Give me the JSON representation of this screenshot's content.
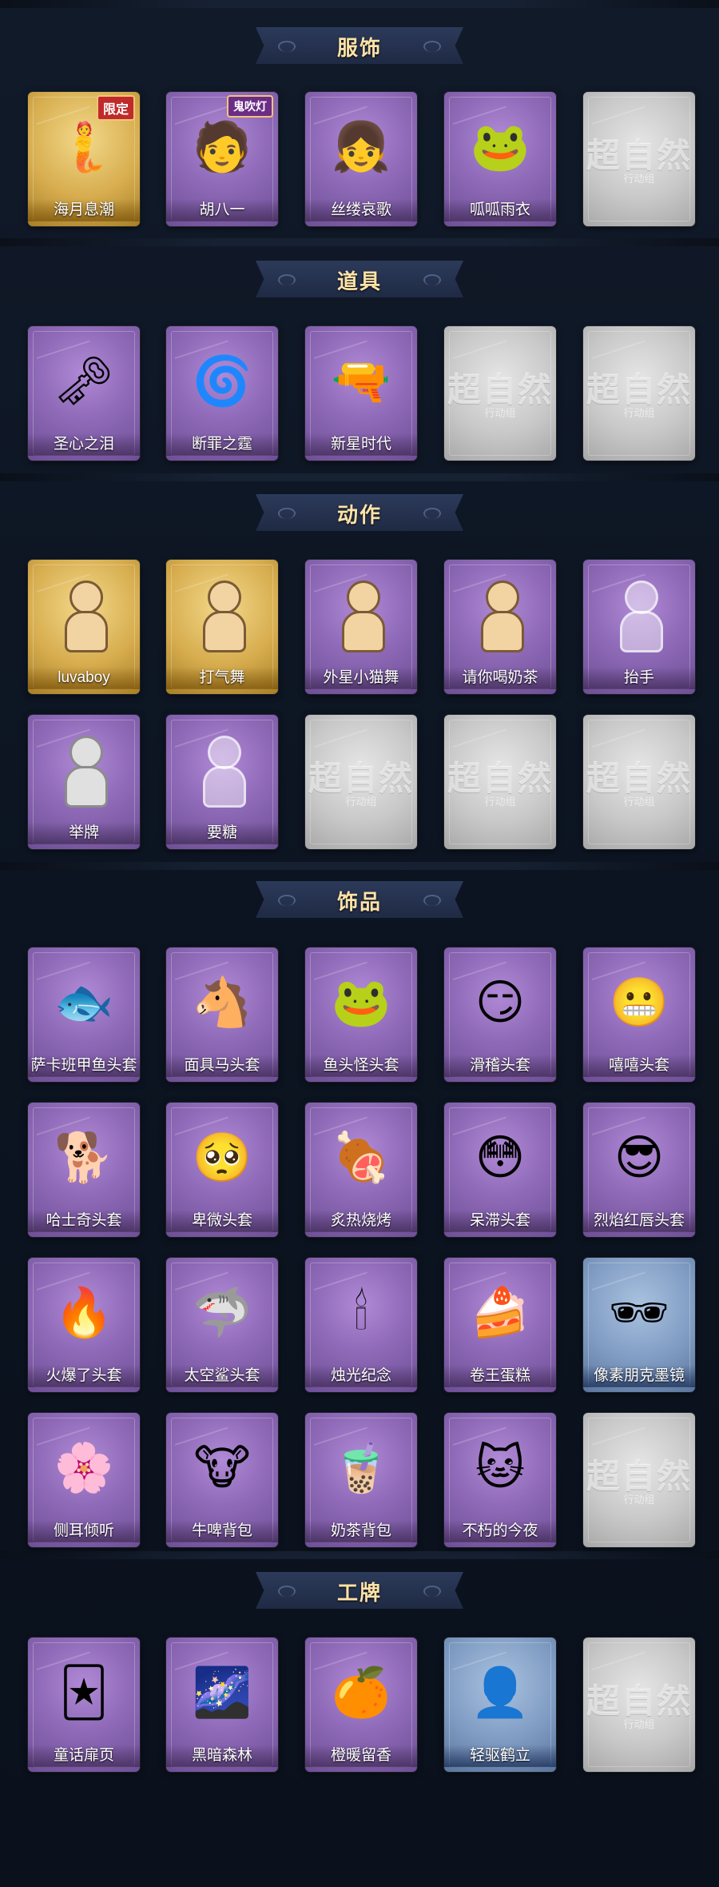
{
  "sections": [
    {
      "title": "服饰",
      "items": [
        {
          "label": "海月息潮",
          "tier": "gold",
          "icon": "sea-goddess-portrait-icon",
          "glyph": "🧜",
          "badge": "限定"
        },
        {
          "label": "胡八一",
          "tier": "purple",
          "icon": "hero-portrait-icon",
          "glyph": "🧑",
          "badge": "鬼吹灯"
        },
        {
          "label": "丝缕哀歌",
          "tier": "purple",
          "icon": "gothic-girl-portrait-icon",
          "glyph": "👧"
        },
        {
          "label": "呱呱雨衣",
          "tier": "purple",
          "icon": "frog-raincoat-girl-icon",
          "glyph": "🐸"
        },
        {
          "label": "",
          "tier": "silver",
          "placeholder": true
        }
      ]
    },
    {
      "title": "道具",
      "items": [
        {
          "label": "圣心之泪",
          "tier": "purple",
          "icon": "ruby-scepter-icon",
          "glyph": "🗝"
        },
        {
          "label": "断罪之霆",
          "tier": "purple",
          "icon": "spiral-orb-icon",
          "glyph": "🌀"
        },
        {
          "label": "新星时代",
          "tier": "purple",
          "icon": "revolver-icon",
          "glyph": "🔫"
        },
        {
          "label": "",
          "tier": "silver",
          "placeholder": true
        },
        {
          "label": "",
          "tier": "silver",
          "placeholder": true
        }
      ]
    },
    {
      "title": "动作",
      "items": [
        {
          "label": "luvaboy",
          "tier": "gold",
          "icon": "dance-pose-icon",
          "figure": "tan"
        },
        {
          "label": "打气舞",
          "tier": "gold",
          "icon": "cheer-dance-icon",
          "figure": "tan"
        },
        {
          "label": "外星小猫舞",
          "tier": "purple",
          "icon": "alien-cat-dance-icon",
          "figure": "tan"
        },
        {
          "label": "请你喝奶茶",
          "tier": "purple",
          "icon": "milk-tea-offer-icon",
          "figure": "tan"
        },
        {
          "label": "抬手",
          "tier": "purple",
          "icon": "raise-hand-icon",
          "figure": "faded"
        },
        {
          "label": "举牌",
          "tier": "purple",
          "icon": "hold-sign-icon",
          "figure": "grey"
        },
        {
          "label": "要糖",
          "tier": "purple",
          "icon": "ask-candy-icon",
          "figure": "faded"
        },
        {
          "label": "",
          "tier": "silver",
          "placeholder": true
        },
        {
          "label": "",
          "tier": "silver",
          "placeholder": true
        },
        {
          "label": "",
          "tier": "silver",
          "placeholder": true
        }
      ]
    },
    {
      "title": "饰品",
      "items": [
        {
          "label": "萨卡班甲鱼头套",
          "tier": "purple",
          "icon": "fish-head-mask-icon",
          "glyph": "🐟"
        },
        {
          "label": "面具马头套",
          "tier": "purple",
          "icon": "horse-head-mask-icon",
          "glyph": "🐴"
        },
        {
          "label": "鱼头怪头套",
          "tier": "purple",
          "icon": "green-fish-mask-icon",
          "glyph": "🐸"
        },
        {
          "label": "滑稽头套",
          "tier": "purple",
          "icon": "funny-face-mask-icon",
          "glyph": "😏"
        },
        {
          "label": "嘻嘻头套",
          "tier": "purple",
          "icon": "grin-face-mask-icon",
          "glyph": "😬"
        },
        {
          "label": "哈士奇头套",
          "tier": "purple",
          "icon": "husky-mask-icon",
          "glyph": "🐕"
        },
        {
          "label": "卑微头套",
          "tier": "purple",
          "icon": "humble-face-mask-icon",
          "glyph": "🥺"
        },
        {
          "label": "炙热烧烤",
          "tier": "purple",
          "icon": "bbq-meat-icon",
          "glyph": "🍖"
        },
        {
          "label": "呆滞头套",
          "tier": "purple",
          "icon": "dazed-face-mask-icon",
          "glyph": "😳"
        },
        {
          "label": "烈焰红唇头套",
          "tier": "purple",
          "icon": "yellow-mouse-mask-icon",
          "glyph": "😎"
        },
        {
          "label": "火爆了头套",
          "tier": "purple",
          "icon": "fire-head-mask-icon",
          "glyph": "🔥"
        },
        {
          "label": "太空鲨头套",
          "tier": "purple",
          "icon": "space-shark-mask-icon",
          "glyph": "🦈"
        },
        {
          "label": "烛光纪念",
          "tier": "purple",
          "icon": "candle-head-icon",
          "glyph": "🕯"
        },
        {
          "label": "卷王蛋糕",
          "tier": "purple",
          "icon": "roll-cake-icon",
          "glyph": "🍰"
        },
        {
          "label": "像素朋克墨镜",
          "tier": "blue",
          "icon": "pixel-sunglasses-icon",
          "glyph": "🕶"
        },
        {
          "label": "侧耳倾听",
          "tier": "purple",
          "icon": "flower-earring-icon",
          "glyph": "🌸"
        },
        {
          "label": "牛啤背包",
          "tier": "purple",
          "icon": "cow-beer-backpack-icon",
          "glyph": "🐮"
        },
        {
          "label": "奶茶背包",
          "tier": "purple",
          "icon": "milk-tea-backpack-icon",
          "glyph": "🧋"
        },
        {
          "label": "不朽的今夜",
          "tier": "purple",
          "icon": "pink-cat-ornament-icon",
          "glyph": "🐱"
        },
        {
          "label": "",
          "tier": "silver",
          "placeholder": true
        }
      ]
    },
    {
      "title": "工牌",
      "items": [
        {
          "label": "童话扉页",
          "tier": "purple",
          "icon": "fairy-tale-card-icon",
          "glyph": "🃏"
        },
        {
          "label": "黑暗森林",
          "tier": "purple",
          "icon": "galaxy-card-icon",
          "glyph": "🌌"
        },
        {
          "label": "橙暖留香",
          "tier": "purple",
          "icon": "orange-card-icon",
          "glyph": "🍊"
        },
        {
          "label": "轻驱鹤立",
          "tier": "blue",
          "icon": "silhouette-card-icon",
          "glyph": "👤"
        },
        {
          "label": "",
          "tier": "silver",
          "placeholder": true
        }
      ]
    }
  ],
  "placeholder": {
    "logo_text": "超自然",
    "sub_text": "行动组"
  }
}
